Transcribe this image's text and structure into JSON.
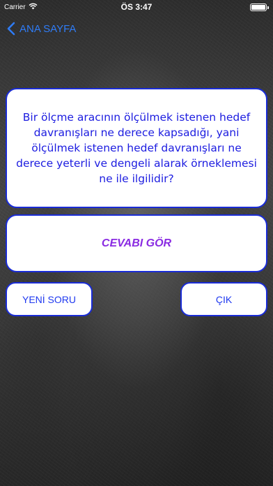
{
  "status_bar": {
    "carrier": "Carrier",
    "time": "ÖS 3:47"
  },
  "nav": {
    "back_label": "ANA SAYFA"
  },
  "question": {
    "text": "Bir ölçme aracının ölçülmek istenen hedef davranışları ne derece kapsadığı, yani ölçülmek istenen hedef davranışları ne derece yeterli ve dengeli alarak  örneklemesi  ne ile ilgilidir?"
  },
  "answer": {
    "reveal_label": "CEVABI GÖR"
  },
  "buttons": {
    "new_question_label": "YENİ SORU",
    "exit_label": "ÇIK"
  },
  "colors": {
    "nav_link": "#2f7cf6",
    "card_border": "#1a2cd6",
    "question_text": "#1c1ce0",
    "answer_text": "#8a2be2",
    "button_text": "#1e38f0"
  },
  "icons": {
    "wifi": "wifi-icon",
    "battery": "battery-icon",
    "back": "chevron-left-icon"
  }
}
